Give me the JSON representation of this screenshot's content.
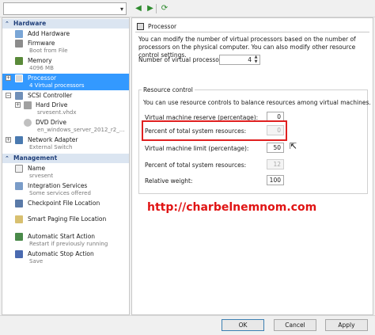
{
  "toolbar": {
    "vm_select_value": ""
  },
  "hardware": {
    "header": "Hardware",
    "items": [
      {
        "label": "Add Hardware",
        "sub": ""
      },
      {
        "label": "Firmware",
        "sub": "Boot from File"
      },
      {
        "label": "Memory",
        "sub": "4096 MB"
      },
      {
        "label": "Processor",
        "sub": "4 Virtual processors"
      },
      {
        "label": "SCSI Controller",
        "sub": ""
      },
      {
        "label": "Hard Drive",
        "sub": "srvesent.vhdx"
      },
      {
        "label": "DVD Drive",
        "sub": "en_windows_server_2012_r2_..."
      },
      {
        "label": "Network Adapter",
        "sub": "External Switch"
      }
    ]
  },
  "management": {
    "header": "Management",
    "items": [
      {
        "label": "Name",
        "sub": "srvesent"
      },
      {
        "label": "Integration Services",
        "sub": "Some services offered"
      },
      {
        "label": "Checkpoint File Location",
        "sub": ""
      },
      {
        "label": "Smart Paging File Location",
        "sub": ""
      },
      {
        "label": "Automatic Start Action",
        "sub": "Restart if previously running"
      },
      {
        "label": "Automatic Stop Action",
        "sub": "Save"
      }
    ]
  },
  "processor": {
    "title": "Processor",
    "description": "You can modify the number of virtual processors based on the number of processors on the physical computer. You can also modify other resource control settings.",
    "vp_label": "Number of virtual processors:",
    "vp_value": "4",
    "group_label": "Resource control",
    "group_desc": "You can use resource controls to balance resources among virtual machines.",
    "reserve_label": "Virtual machine reserve (percentage):",
    "reserve_value": "0",
    "pct1_label": "Percent of total system resources:",
    "pct1_value": "0",
    "limit_label": "Virtual machine limit (percentage):",
    "limit_value": "50",
    "pct2_label": "Percent of total system resources:",
    "pct2_value": "12",
    "weight_label": "Relative weight:",
    "weight_value": "100"
  },
  "watermark": "http://charbelnemnom.com",
  "buttons": {
    "ok": "OK",
    "cancel": "Cancel",
    "apply": "Apply"
  },
  "colors": {
    "selection": "#3399ff",
    "section_header_bg": "#dbe5f1",
    "highlight": "#e02020",
    "watermark": "#e01414"
  }
}
